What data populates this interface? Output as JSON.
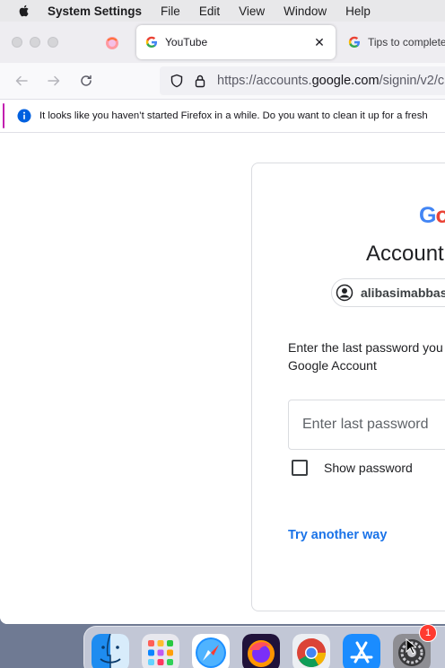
{
  "menubar": {
    "app_name": "System Settings",
    "items": [
      "File",
      "Edit",
      "View",
      "Window",
      "Help"
    ]
  },
  "browser": {
    "tabs": [
      {
        "title": "YouTube",
        "active": true,
        "icon": "google-g-icon"
      },
      {
        "title": "Tips to complete",
        "active": false,
        "icon": "google-g-icon"
      }
    ],
    "url": {
      "prefix": "https://accounts.",
      "domain": "google.com",
      "suffix": "/signin/v2/c"
    },
    "notification": "It looks like you haven’t started Firefox in a while. Do you want to clean it up for a fresh"
  },
  "signin": {
    "logo_letters": [
      "G",
      "o"
    ],
    "heading": "Account",
    "email": "alibasimabbas",
    "description": "Enter the last password you Google Account",
    "description_line1": "Enter the last password you",
    "description_line2": "Google Account",
    "password_placeholder": "Enter last password",
    "show_password_label": "Show password",
    "try_another_way": "Try another way"
  },
  "dock": {
    "icons": [
      "finder-icon",
      "launchpad-icon",
      "safari-icon",
      "firefox-icon",
      "chrome-icon",
      "app-store-icon",
      "system-settings-icon"
    ],
    "settings_badge": "1"
  },
  "colors": {
    "link": "#1a73e8",
    "google_blue": "#4285f4",
    "google_red": "#ea4335",
    "notice_accent": "#c21fb0",
    "info_blue": "#0060df"
  }
}
